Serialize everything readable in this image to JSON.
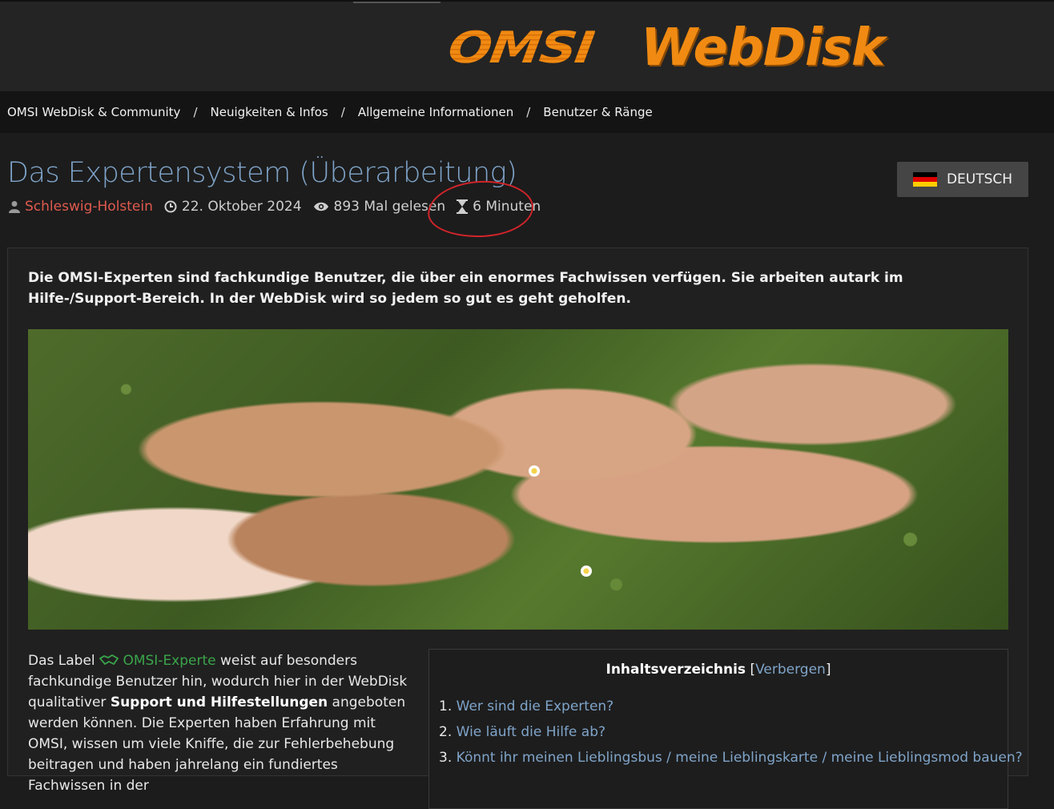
{
  "header": {
    "logo_left": "OMSI",
    "logo_right": "WebDisk"
  },
  "breadcrumb": [
    "OMSI WebDisk & Community",
    "Neuigkeiten & Infos",
    "Allgemeine Informationen",
    "Benutzer & Ränge"
  ],
  "breadcrumb_separator": "/",
  "article": {
    "title": "Das Expertensystem (Überarbeitung)",
    "author": "Schleswig-Holstein",
    "date": "22. Oktober 2024",
    "views": "893 Mal gelesen",
    "reading_time": "6 Minuten",
    "language_button": "DEUTSCH",
    "lead": "Die OMSI-Experten sind fachkundige Benutzer, die über ein enormes Fachwissen verfügen. Sie arbeiten autark im Hilfe-/Support-Bereich. In der WebDisk wird so jedem so gut es geht geholfen.",
    "body": {
      "part1": "Das Label ",
      "expert_label": "OMSI-Experte",
      "part2": " weist auf besonders fachkundige Benutzer hin, wodurch hier in der WebDisk qualitativer ",
      "bold": "Support und Hilfestellungen",
      "part3": " angeboten werden können. Die Experten haben Erfahrung mit OMSI, wissen um viele Kniffe, die zur Fehlerbehebung beitragen und haben jahrelang ein fundiertes Fachwissen in der"
    }
  },
  "toc": {
    "title": "Inhaltsverzeichnis",
    "hide_label": "Verbergen",
    "items": [
      {
        "num": "1.",
        "label": "Wer sind die Experten?"
      },
      {
        "num": "2.",
        "label": "Wie läuft die Hilfe ab?"
      },
      {
        "num": "3.",
        "label": "Könnt ihr meinen Lieblingsbus / meine Lieblingskarte / meine Lieblingsmod bauen?"
      }
    ]
  },
  "colors": {
    "accent_orange": "#f08a12",
    "title_blue": "#7fa4c9",
    "author_red": "#e05a4e",
    "expert_green": "#3aa54a",
    "annotation_red": "#d0242a"
  },
  "icons": {
    "author": "user-icon",
    "date": "clock-icon",
    "views": "eye-icon",
    "reading_time": "hourglass-icon",
    "language": "german-flag-icon",
    "expert": "handshake-icon"
  }
}
